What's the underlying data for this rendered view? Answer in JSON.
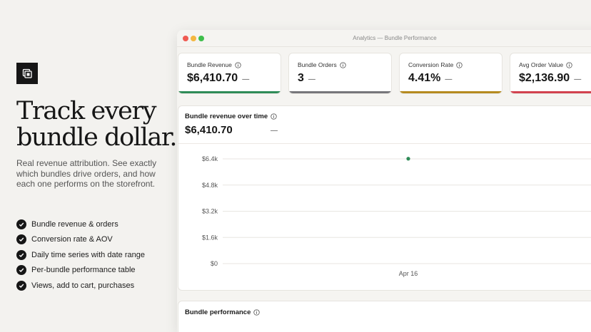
{
  "hero": {
    "headline_line1": "Track every",
    "headline_line2": "bundle dollar.",
    "description": "Real revenue attribution. See exactly which bundles drive orders, and how each one performs on the storefront.",
    "features": [
      "Bundle revenue & orders",
      "Conversion rate & AOV",
      "Daily time series with date range",
      "Per-bundle performance table",
      "Views, add to cart, purchases"
    ]
  },
  "window": {
    "title": "Analytics — Bundle Performance"
  },
  "kpis": [
    {
      "label": "Bundle Revenue",
      "value": "$6,410.70",
      "delta": "—",
      "color": "#2e8b57"
    },
    {
      "label": "Bundle Orders",
      "value": "3",
      "delta": "—",
      "color": "#76767a"
    },
    {
      "label": "Conversion Rate",
      "value": "4.41%",
      "delta": "—",
      "color": "#b58a1f"
    },
    {
      "label": "Avg Order Value",
      "value": "$2,136.90",
      "delta": "—",
      "color": "#d2424f"
    }
  ],
  "revenue_chart": {
    "title": "Bundle revenue over time",
    "value": "$6,410.70",
    "delta": "—"
  },
  "performance": {
    "title": "Bundle performance"
  },
  "icons": {
    "logo": "bundle-box-icon",
    "check": "check-icon",
    "info": "info-icon"
  },
  "chart_data": {
    "type": "line",
    "x": [
      "Apr 16"
    ],
    "series": [
      {
        "values": [
          6410.7
        ],
        "color": "#2e8b57"
      }
    ],
    "y_ticks": [
      "$6.4k",
      "$4.8k",
      "$3.2k",
      "$1.6k",
      "$0"
    ],
    "y_tick_values": [
      6400,
      4800,
      3200,
      1600,
      0
    ],
    "ylim": [
      0,
      6400
    ],
    "grid": true
  }
}
